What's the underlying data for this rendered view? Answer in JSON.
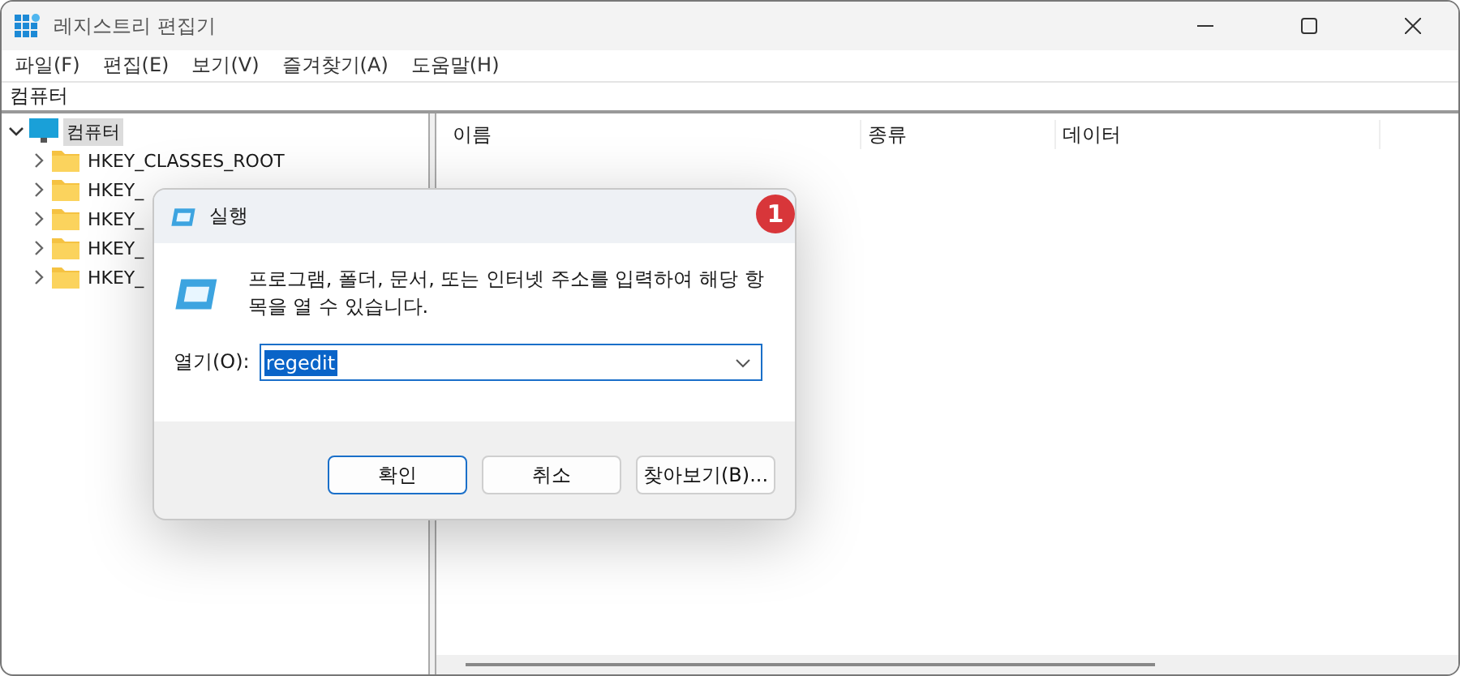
{
  "window": {
    "title": "레지스트리 편집기"
  },
  "menu": [
    "파일(F)",
    "편집(E)",
    "보기(V)",
    "즐겨찾기(A)",
    "도움말(H)"
  ],
  "address": "컴퓨터",
  "tree": {
    "label": "컴퓨터",
    "expanded": true,
    "selected": true,
    "children": [
      {
        "label": "HKEY_CLASSES_ROOT",
        "expanded": false
      },
      {
        "label": "HKEY_",
        "expanded": false
      },
      {
        "label": "HKEY_",
        "expanded": false
      },
      {
        "label": "HKEY_",
        "expanded": false
      },
      {
        "label": "HKEY_",
        "expanded": false
      }
    ]
  },
  "columns": [
    "이름",
    "종류",
    "데이터"
  ],
  "dialog": {
    "title": "실행",
    "message": "프로그램, 폴더, 문서, 또는 인터넷 주소를 입력하여 해당 항목을 열 수 있습니다.",
    "open_label": "열기(O):",
    "value": "regedit",
    "value_selected": true,
    "buttons": [
      {
        "label": "확인",
        "default": true
      },
      {
        "label": "취소",
        "default": false
      },
      {
        "label": "찾아보기(B)...",
        "default": false
      }
    ]
  },
  "annotation": {
    "badge": "1"
  }
}
